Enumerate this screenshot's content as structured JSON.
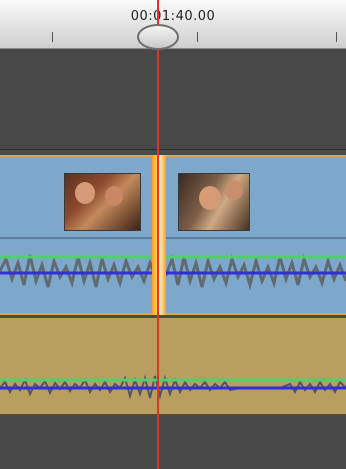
{
  "timeline": {
    "current_time": "00:01:40.00"
  }
}
